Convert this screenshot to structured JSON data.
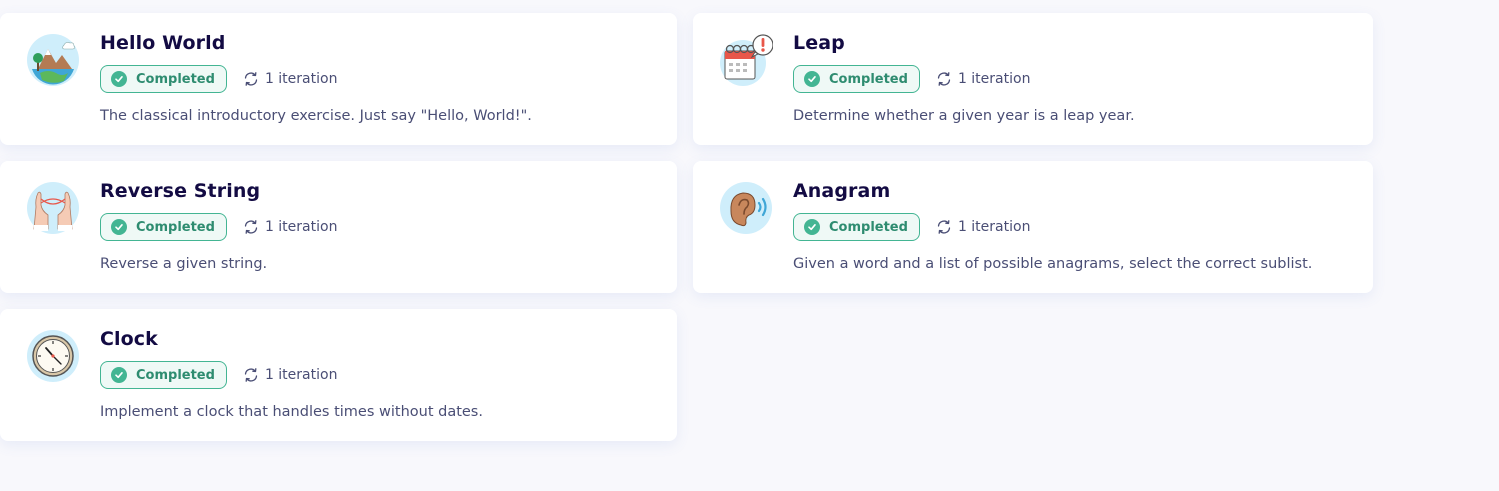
{
  "exercises": [
    {
      "title": "Hello World",
      "status": "Completed",
      "iterations": "1 iteration",
      "description": "The classical introductory exercise. Just say \"Hello, World!\".",
      "icon": "hello-world-icon"
    },
    {
      "title": "Leap",
      "status": "Completed",
      "iterations": "1 iteration",
      "description": "Determine whether a given year is a leap year.",
      "icon": "leap-calendar-icon"
    },
    {
      "title": "Reverse String",
      "status": "Completed",
      "iterations": "1 iteration",
      "description": "Reverse a given string.",
      "icon": "reverse-string-icon"
    },
    {
      "title": "Anagram",
      "status": "Completed",
      "iterations": "1 iteration",
      "description": "Given a word and a list of possible anagrams, select the correct sublist.",
      "icon": "anagram-ear-icon"
    },
    {
      "title": "Clock",
      "status": "Completed",
      "iterations": "1 iteration",
      "description": "Implement a clock that handles times without dates.",
      "icon": "clock-icon"
    }
  ],
  "colors": {
    "completed_accent": "#43b593",
    "title": "#130b43",
    "text": "#4a4e75",
    "background": "#f8f8fc"
  }
}
